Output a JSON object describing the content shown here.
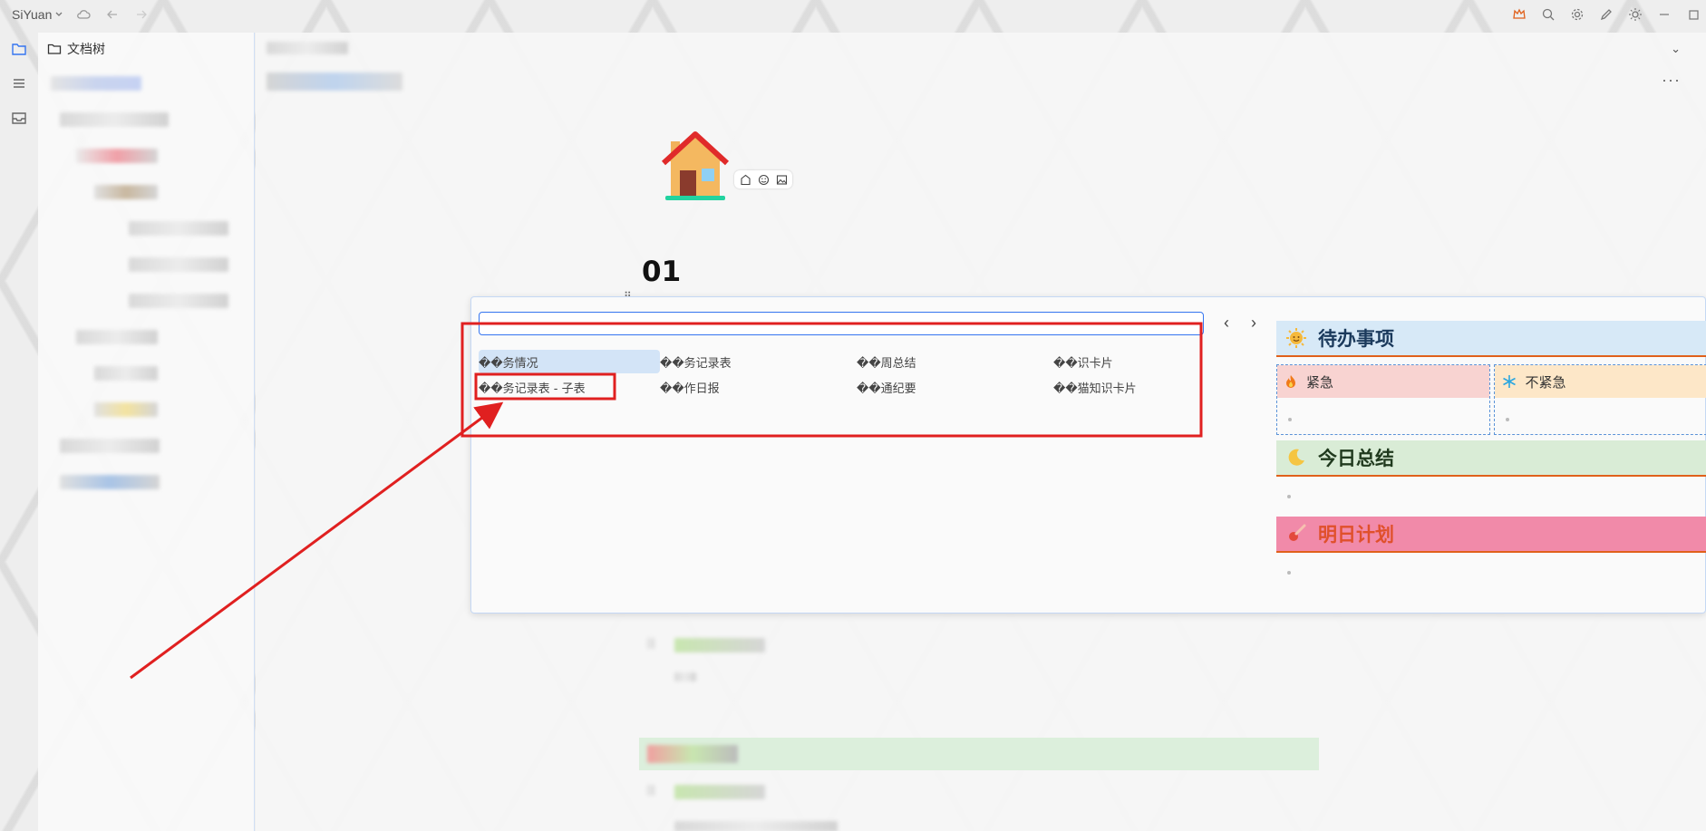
{
  "app": {
    "brand": "SiYuan"
  },
  "dock": {
    "items": [
      "file-tree-icon",
      "outline-icon",
      "inbox-icon"
    ]
  },
  "doc_tree": {
    "title": "文档树"
  },
  "document": {
    "title": "01",
    "more_label": "···"
  },
  "template_picker": {
    "search_value": "",
    "prev_label": "‹",
    "next_label": "›",
    "items": [
      {
        "label": "��务情况"
      },
      {
        "label": "��务记录表"
      },
      {
        "label": "��周总结"
      },
      {
        "label": "��识卡片"
      },
      {
        "label": "��务记录表 - 子表"
      },
      {
        "label": "��作日报"
      },
      {
        "label": "��通纪要"
      },
      {
        "label": "��猫知识卡片"
      }
    ],
    "selected_index": 0,
    "preview": {
      "todo_heading": "待办事项",
      "urgent_label": "紧急",
      "not_urgent_label": "不紧急",
      "summary_heading": "今日总结",
      "plan_heading": "明日计划"
    }
  },
  "colors": {
    "accent": "#3575f0",
    "annotation": "#e02020",
    "selected_bg": "#d3e4f7"
  }
}
